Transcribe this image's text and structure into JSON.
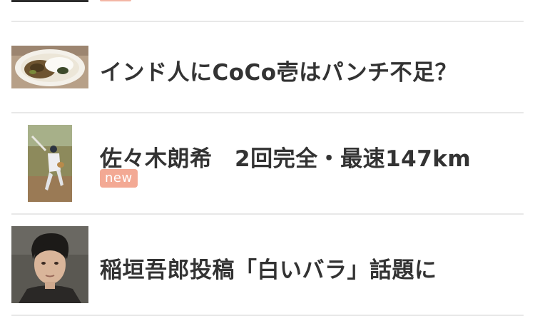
{
  "news_list": {
    "items": [
      {
        "headline": "インド人にCoCo壱はパンチ不足？",
        "thumbnail_icon": "curry-plate-photo"
      },
      {
        "headline": "佐々木朗希　2回完全・最速147km",
        "badge": "new",
        "thumbnail_icon": "baseball-pitcher-photo"
      },
      {
        "headline": "稲垣吾郎投稿「白いバラ」話題に",
        "thumbnail_icon": "man-portrait-photo"
      }
    ]
  },
  "colors": {
    "headline_text": "#333333",
    "badge_background": "#f3a994",
    "badge_text": "#ffffff",
    "divider": "#e8e8e8"
  }
}
